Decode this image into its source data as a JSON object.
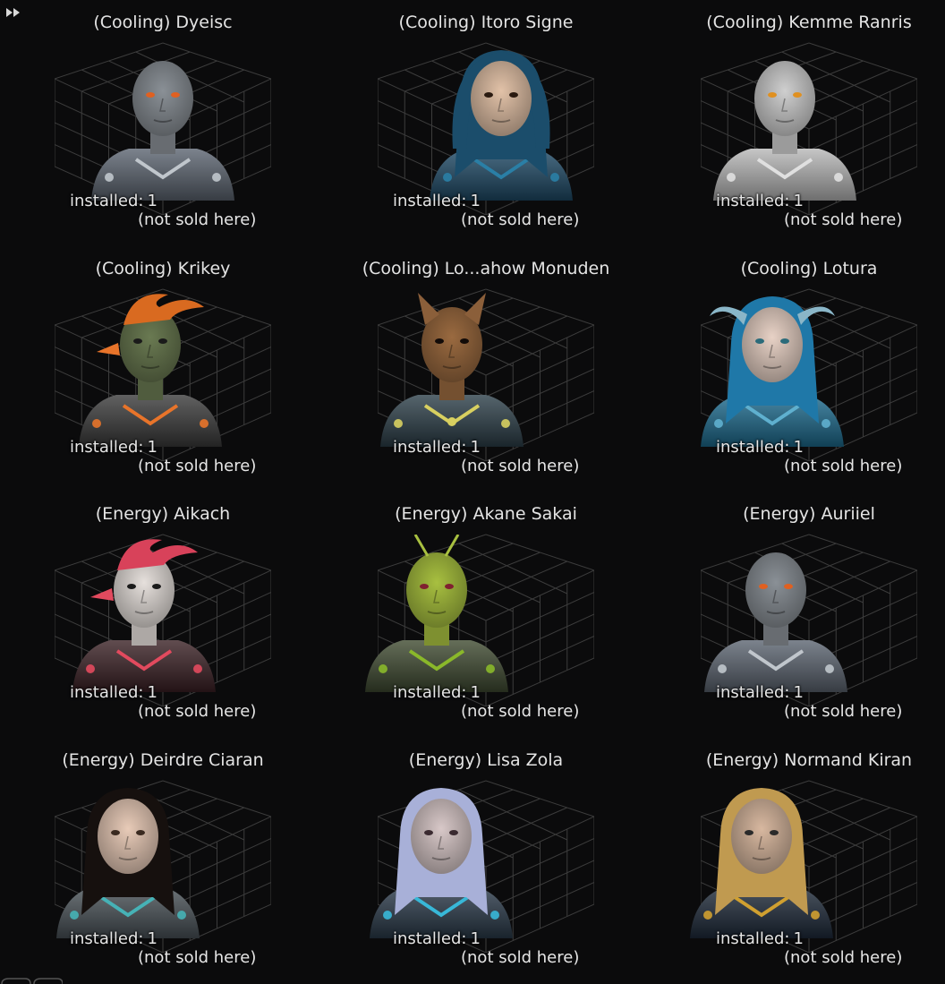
{
  "toolbar": {
    "fast_forward_icon": "fast-forward-icon"
  },
  "colors": {
    "background": "#0b0b0c",
    "text": "#e4e4e4",
    "grid_lines": "#3c3c3c"
  },
  "characters": [
    {
      "name": "(Cooling) Dyeisc",
      "installed_label": "installed:",
      "installed": "1",
      "availability": "(not sold here)",
      "portrait": "grey-brute-portrait"
    },
    {
      "name": "(Cooling) Itoro Signe",
      "installed_label": "installed:",
      "installed": "1",
      "availability": "(not sold here)",
      "portrait": "hooded-woman-portrait"
    },
    {
      "name": "(Cooling) Kemme Ranris",
      "installed_label": "installed:",
      "installed": "1",
      "availability": "(not sold here)",
      "portrait": "white-reptilian-portrait"
    },
    {
      "name": "(Cooling) Krikey",
      "installed_label": "installed:",
      "installed": "1",
      "availability": "(not sold here)",
      "portrait": "crested-bird-portrait"
    },
    {
      "name": "(Cooling) Lo...ahow Monuden",
      "installed_label": "installed:",
      "installed": "1",
      "availability": "(not sold here)",
      "portrait": "squirrel-portrait"
    },
    {
      "name": "(Cooling) Lotura",
      "installed_label": "installed:",
      "installed": "1",
      "availability": "(not sold here)",
      "portrait": "blue-haired-horned-portrait"
    },
    {
      "name": "(Energy) Aikach",
      "installed_label": "installed:",
      "installed": "1",
      "availability": "(not sold here)",
      "portrait": "red-crested-bird-portrait"
    },
    {
      "name": "(Energy) Akane Sakai",
      "installed_label": "installed:",
      "installed": "1",
      "availability": "(not sold here)",
      "portrait": "green-insectoid-portrait"
    },
    {
      "name": "(Energy) Auriiel",
      "installed_label": "installed:",
      "installed": "1",
      "availability": "(not sold here)",
      "portrait": "grey-brute-portrait"
    },
    {
      "name": "(Energy) Deirdre Ciaran",
      "installed_label": "installed:",
      "installed": "1",
      "availability": "(not sold here)",
      "portrait": "dark-haired-woman-portrait"
    },
    {
      "name": "(Energy) Lisa Zola",
      "installed_label": "installed:",
      "installed": "1",
      "availability": "(not sold here)",
      "portrait": "silver-haired-woman-portrait"
    },
    {
      "name": "(Energy) Normand Kiran",
      "installed_label": "installed:",
      "installed": "1",
      "availability": "(not sold here)",
      "portrait": "young-man-portrait"
    }
  ]
}
